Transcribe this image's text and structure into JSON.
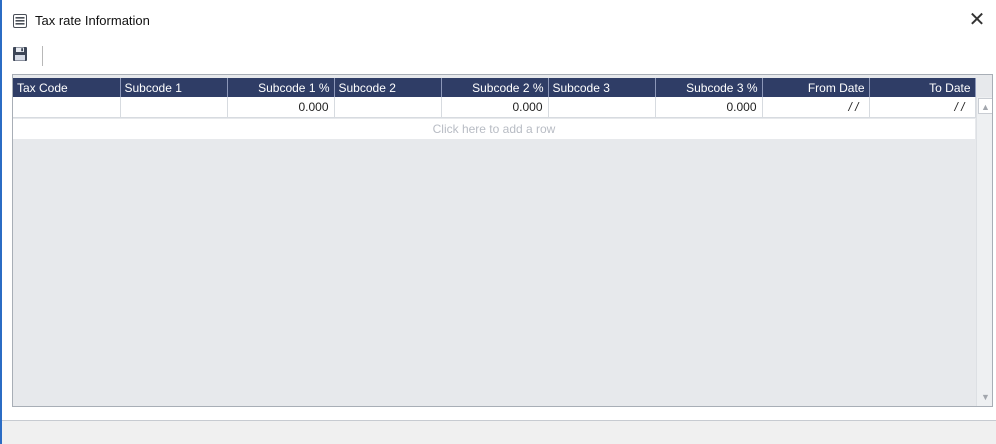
{
  "window": {
    "title": "Tax rate Information",
    "title_icon": "document-list-icon",
    "close_glyph": "✕"
  },
  "toolbar": {
    "save_icon": "floppy-disk-icon"
  },
  "grid": {
    "columns": [
      "Tax Code",
      "Subcode 1",
      "Subcode 1 %",
      "Subcode 2",
      "Subcode 2 %",
      "Subcode 3",
      "Subcode 3 %",
      "From Date",
      "To Date"
    ],
    "rows": [
      [
        "",
        "",
        "0.000",
        "",
        "0.000",
        "",
        "0.000",
        "/ /",
        "/ /"
      ]
    ],
    "add_row_text": "Click here to add a row"
  },
  "scrollbar": {
    "up_glyph": "▲",
    "down_glyph": "▼"
  },
  "colors": {
    "header_bg": "#2f3d66",
    "grid_bg": "#e7e9ec",
    "accent_border": "#2b6cc4"
  }
}
